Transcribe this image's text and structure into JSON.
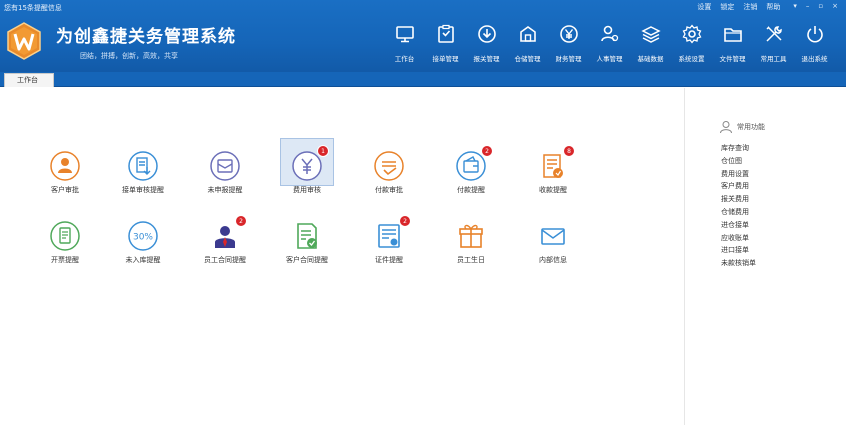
{
  "header": {
    "notice": "您有15条提醒信息",
    "title": "为创鑫捷关务管理系统",
    "slogan": "团结，拼搏，创新，高效，共享",
    "top_links": [
      "设置",
      "锁定",
      "注销",
      "帮助"
    ],
    "window_buttons": [
      "▾",
      "–",
      "▫",
      "×"
    ]
  },
  "nav": [
    {
      "label": "工作台",
      "icon": "monitor-icon"
    },
    {
      "label": "接单管理",
      "icon": "clipboard-icon"
    },
    {
      "label": "报关管理",
      "icon": "download-circle-icon"
    },
    {
      "label": "仓储管理",
      "icon": "warehouse-icon"
    },
    {
      "label": "财务管理",
      "icon": "yen-icon"
    },
    {
      "label": "人事管理",
      "icon": "user-gear-icon"
    },
    {
      "label": "基础数据",
      "icon": "layers-icon"
    },
    {
      "label": "系统设置",
      "icon": "gear-icon"
    },
    {
      "label": "文件管理",
      "icon": "folder-icon"
    },
    {
      "label": "常用工具",
      "icon": "tools-icon"
    },
    {
      "label": "退出系统",
      "icon": "power-icon"
    }
  ],
  "tabs": [
    "工作台"
  ],
  "tiles": [
    {
      "label": "客户审批",
      "icon": "customer-approve-icon",
      "badge": ""
    },
    {
      "label": "接单审核提醒",
      "icon": "order-review-icon",
      "badge": ""
    },
    {
      "label": "未申报提醒",
      "icon": "undeclared-icon",
      "badge": ""
    },
    {
      "label": "费用审核",
      "icon": "fee-review-icon",
      "badge": "1"
    },
    {
      "label": "付款审批",
      "icon": "payment-approve-icon",
      "badge": ""
    },
    {
      "label": "付款提醒",
      "icon": "payment-remind-icon",
      "badge": "2"
    },
    {
      "label": "收款提醒",
      "icon": "receipt-remind-icon",
      "badge": "8"
    },
    {
      "label": "开票提醒",
      "icon": "invoice-remind-icon",
      "badge": ""
    },
    {
      "label": "未入库提醒",
      "icon": "not-stored-icon",
      "badge": ""
    },
    {
      "label": "员工合同提醒",
      "icon": "staff-contract-icon",
      "badge": "2"
    },
    {
      "label": "客户合同提醒",
      "icon": "customer-contract-icon",
      "badge": ""
    },
    {
      "label": "证件提醒",
      "icon": "certificate-icon",
      "badge": "2"
    },
    {
      "label": "员工生日",
      "icon": "gift-icon",
      "badge": ""
    },
    {
      "label": "内部信息",
      "icon": "mail-icon",
      "badge": ""
    }
  ],
  "quick": {
    "title": "常用功能",
    "items": [
      "库存查询",
      "仓位图",
      "费用设置",
      "客户费用",
      "报关费用",
      "仓储费用",
      "进仓接单",
      "应收账单",
      "进口接单",
      "未款核销单"
    ]
  },
  "colors": {
    "header": "#1565b8",
    "badge": "#d9262a",
    "orange": "#e8822a",
    "blue": "#3a8fd6",
    "green": "#4fa85a",
    "purple": "#6b4fa8"
  }
}
